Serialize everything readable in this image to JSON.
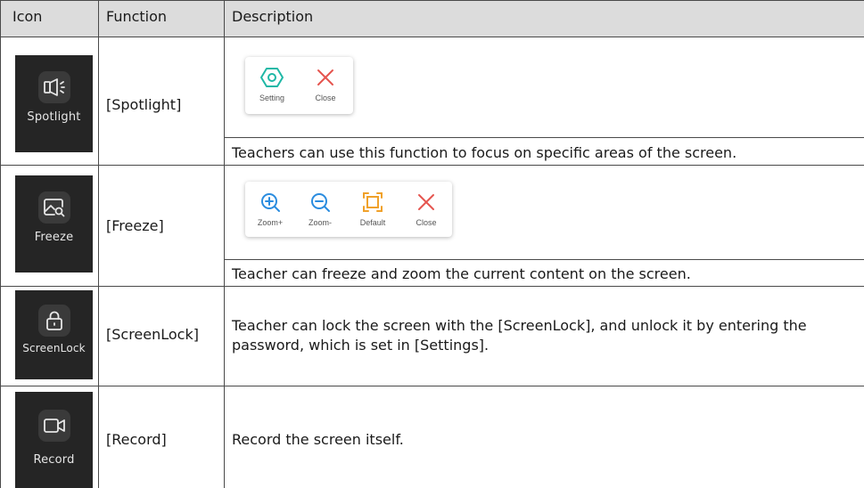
{
  "table": {
    "headers": {
      "icon": "Icon",
      "function": "Function",
      "description": "Description"
    },
    "rows": [
      {
        "tile_label": "Spotlight",
        "tile_icon": "speaker-spotlight-icon",
        "function": "[Spotlight]",
        "toolbar": [
          {
            "label": "Setting",
            "icon": "hexagon-setting-icon",
            "color": "#1fb8a6"
          },
          {
            "label": "Close",
            "icon": "close-x-icon",
            "color": "#e5554f"
          }
        ],
        "description": "Teachers can use this function to focus on specific areas of the screen."
      },
      {
        "tile_label": "Freeze",
        "tile_icon": "image-search-freeze-icon",
        "function": "[Freeze]",
        "toolbar": [
          {
            "label": "Zoom+",
            "icon": "zoom-in-icon",
            "color": "#2a8cdf"
          },
          {
            "label": "Zoom-",
            "icon": "zoom-out-icon",
            "color": "#2a8cdf"
          },
          {
            "label": "Default",
            "icon": "frame-default-icon",
            "color": "#f0a12a"
          },
          {
            "label": "Close",
            "icon": "close-x-icon",
            "color": "#e5554f"
          }
        ],
        "description": "Teacher can freeze and zoom the current content on the screen."
      },
      {
        "tile_label": "ScreenLock",
        "tile_icon": "padlock-icon",
        "function": "[ScreenLock]",
        "description": "Teacher can lock the screen with the [ScreenLock], and unlock it by entering the password, which is set in [Settings]."
      },
      {
        "tile_label": "Record",
        "tile_icon": "video-camera-icon",
        "function": "[Record]",
        "description": "Record the screen itself."
      }
    ]
  }
}
